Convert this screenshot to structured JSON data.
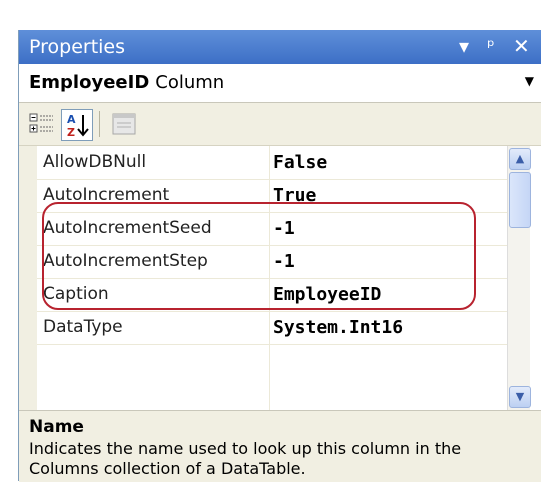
{
  "panel": {
    "title": "Properties",
    "buttons": {
      "dropdown": "▾",
      "pin": "ᵖ",
      "close": "✕"
    }
  },
  "selector": {
    "object_name": "EmployeeID",
    "object_kind": "Column",
    "dropdown_arrow": "▼"
  },
  "toolbar": {
    "icons": [
      "categorized-icon",
      "alphabetical-icon",
      "property-pages-icon"
    ]
  },
  "properties": [
    {
      "name": "AllowDBNull",
      "value": "False"
    },
    {
      "name": "AutoIncrement",
      "value": "True"
    },
    {
      "name": "AutoIncrementSeed",
      "value": "-1"
    },
    {
      "name": "AutoIncrementStep",
      "value": "-1"
    },
    {
      "name": "Caption",
      "value": "EmployeeID"
    },
    {
      "name": "DataType",
      "value": "System.Int16"
    }
  ],
  "description": {
    "name": "Name",
    "text": "Indicates the name used to look up this column in the Columns collection of a DataTable."
  },
  "colors": {
    "title_bar": "#3d6fc6",
    "highlight": "#b8232f"
  }
}
